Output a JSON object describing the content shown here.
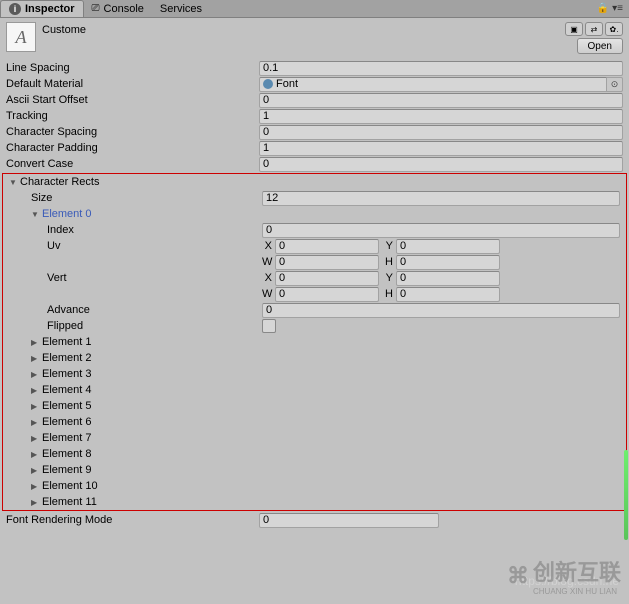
{
  "tabs": {
    "inspector": "Inspector",
    "console": "Console",
    "services": "Services"
  },
  "asset_name": "Custome",
  "open_button": "Open",
  "props": {
    "line_spacing": {
      "label": "Line Spacing",
      "value": "0.1"
    },
    "default_material": {
      "label": "Default Material",
      "value": "Font"
    },
    "ascii_start": {
      "label": "Ascii Start Offset",
      "value": "0"
    },
    "tracking": {
      "label": "Tracking",
      "value": "1"
    },
    "char_spacing": {
      "label": "Character Spacing",
      "value": "0"
    },
    "char_padding": {
      "label": "Character Padding",
      "value": "1"
    },
    "convert_case": {
      "label": "Convert Case",
      "value": "0"
    }
  },
  "char_rects": {
    "label": "Character Rects",
    "size_label": "Size",
    "size_value": "12",
    "element0": {
      "label": "Element 0",
      "index_label": "Index",
      "index_value": "0",
      "uv_label": "Uv",
      "vert_label": "Vert",
      "advance_label": "Advance",
      "advance_value": "0",
      "flipped_label": "Flipped",
      "xywh": {
        "x": "0",
        "y": "0",
        "w": "0",
        "h": "0"
      },
      "xywh_labels": {
        "x": "X",
        "y": "Y",
        "w": "W",
        "h": "H"
      }
    },
    "elements": [
      "Element 1",
      "Element 2",
      "Element 3",
      "Element 4",
      "Element 5",
      "Element 6",
      "Element 7",
      "Element 8",
      "Element 9",
      "Element 10",
      "Element 11"
    ]
  },
  "font_rendering": {
    "label": "Font Rendering Mode",
    "value": "0"
  },
  "watermark_url": "https://blog.csdn.ne",
  "logo_text": "创新互联",
  "logo_sub": "CHUANG XIN HU LIAN"
}
